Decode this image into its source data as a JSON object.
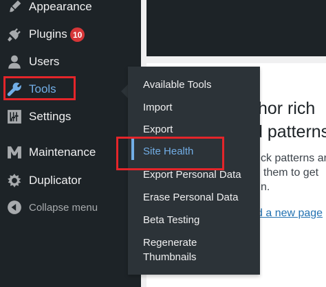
{
  "sidebar": {
    "items": [
      {
        "key": "appearance",
        "label": "Appearance",
        "icon": "paintbrush-icon"
      },
      {
        "key": "plugins",
        "label": "Plugins",
        "icon": "plugin-icon",
        "badge": "10"
      },
      {
        "key": "users",
        "label": "Users",
        "icon": "users-icon"
      },
      {
        "key": "tools",
        "label": "Tools",
        "icon": "wrench-icon",
        "active": true
      },
      {
        "key": "settings",
        "label": "Settings",
        "icon": "settings-sliders-icon"
      },
      {
        "key": "maintenance",
        "label": "Maintenance",
        "icon": "maintenance-m-icon"
      },
      {
        "key": "duplicator",
        "label": "Duplicator",
        "icon": "duplicator-icon"
      }
    ],
    "collapse_label": "Collapse menu"
  },
  "submenu": {
    "items": [
      "Available Tools",
      "Import",
      "Export",
      "Site Health",
      "Export Personal Data",
      "Erase Personal Data",
      "Beta Testing",
      "Regenerate",
      "Thumbnails"
    ],
    "current": "Site Health"
  },
  "content": {
    "heading_line1": "thor rich",
    "heading_line2": "d patterns",
    "body_line1": "ck patterns ar",
    "body_line2": "them to get",
    "body_line3": "n.",
    "link_text": "d a new page"
  },
  "colors": {
    "sidebar_bg": "#1d2327",
    "submenu_bg": "#2c3338",
    "accent": "#72aee6",
    "badge": "#d63638",
    "highlight_box": "#e5252a",
    "link": "#2271b1"
  }
}
